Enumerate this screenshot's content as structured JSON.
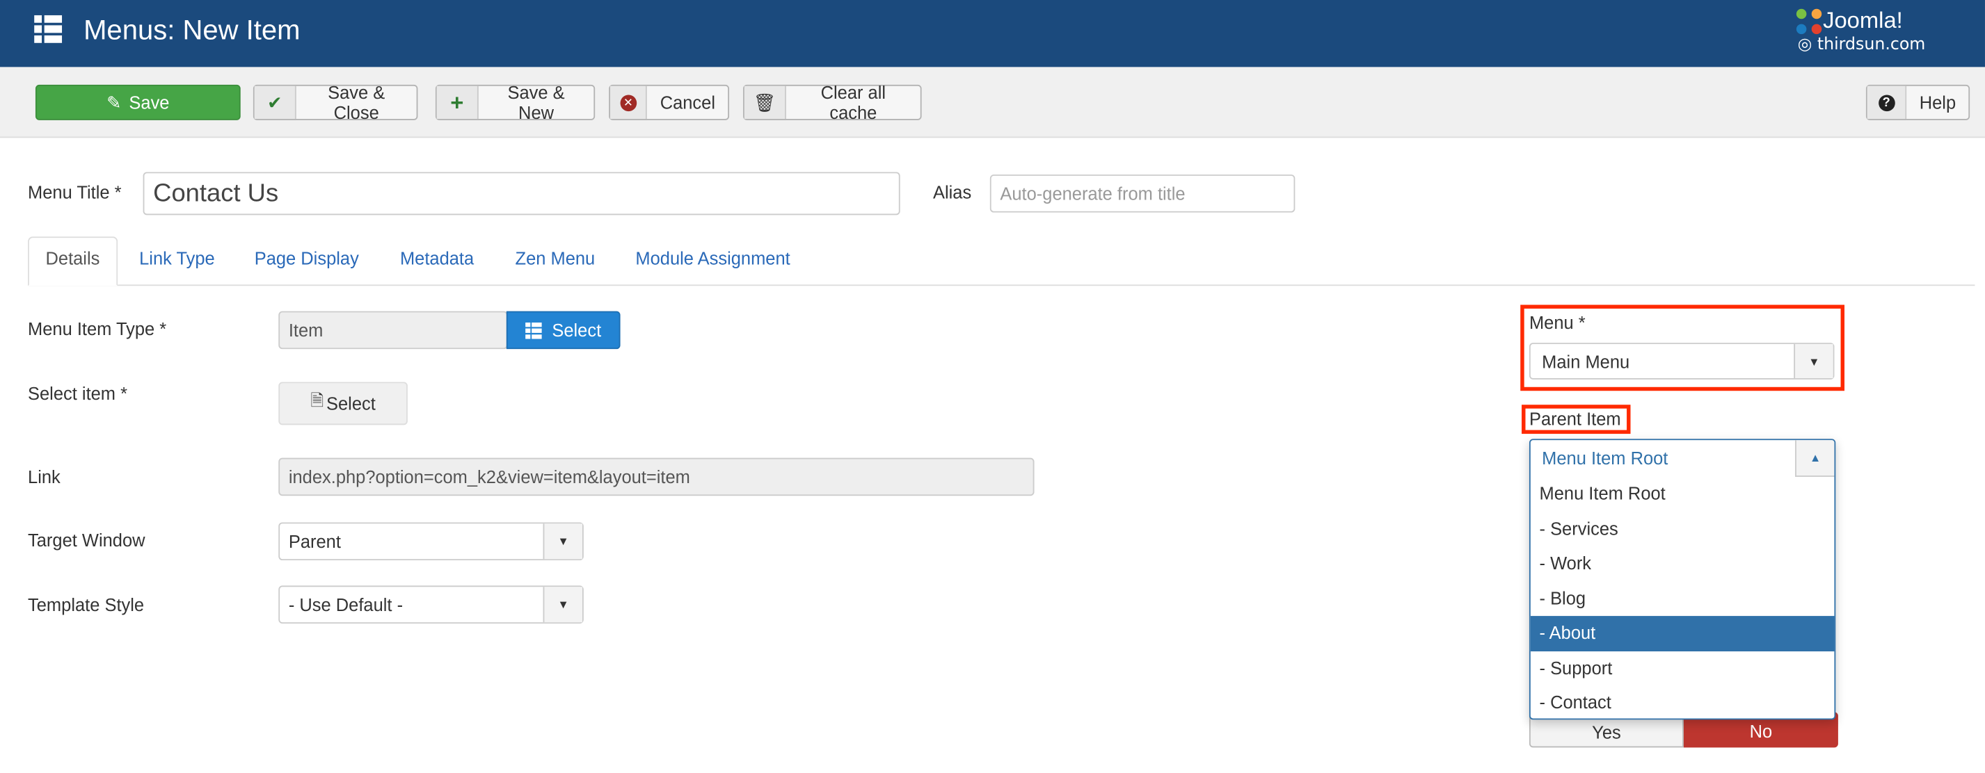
{
  "header": {
    "title": "Menus: New Item",
    "logo_text": "Joomla!",
    "watermark": "thirdsun.com",
    "colors": {
      "bar": "#1b4a7d"
    }
  },
  "toolbar": {
    "save": "Save",
    "save_close": "Save & Close",
    "save_new": "Save & New",
    "cancel": "Cancel",
    "clear_cache": "Clear all cache",
    "help": "Help",
    "colors": {
      "save": "#46a546"
    }
  },
  "form": {
    "menu_title_label": "Menu Title *",
    "menu_title_value": "Contact Us",
    "alias_label": "Alias",
    "alias_placeholder": "Auto-generate from title"
  },
  "tabs": [
    {
      "label": "Details",
      "active": true
    },
    {
      "label": "Link Type"
    },
    {
      "label": "Page Display"
    },
    {
      "label": "Metadata"
    },
    {
      "label": "Zen Menu"
    },
    {
      "label": "Module Assignment"
    }
  ],
  "details": {
    "menu_item_type_label": "Menu Item Type *",
    "menu_item_type_value": "Item",
    "select_label": "Select",
    "select_item_label": "Select item *",
    "select_item_button": "Select",
    "link_label": "Link",
    "link_value": "index.php?option=com_k2&view=item&layout=item",
    "target_window_label": "Target Window",
    "target_window_value": "Parent",
    "template_style_label": "Template Style",
    "template_style_value": "- Use Default -"
  },
  "sidebar": {
    "menu_label": "Menu *",
    "menu_value": "Main Menu",
    "parent_label": "Parent Item",
    "parent_value": "Menu Item Root",
    "parent_options": [
      "Menu Item Root",
      "- Services",
      "- Work",
      "- Blog",
      "- About",
      "- Support",
      "- Contact"
    ],
    "highlighted_option": "- About",
    "toggle": {
      "yes": "Yes",
      "no": "No",
      "selected": "No"
    },
    "colors": {
      "highlight": "#3071a9",
      "annotation": "#ff2a00",
      "no": "#bd362f"
    }
  }
}
